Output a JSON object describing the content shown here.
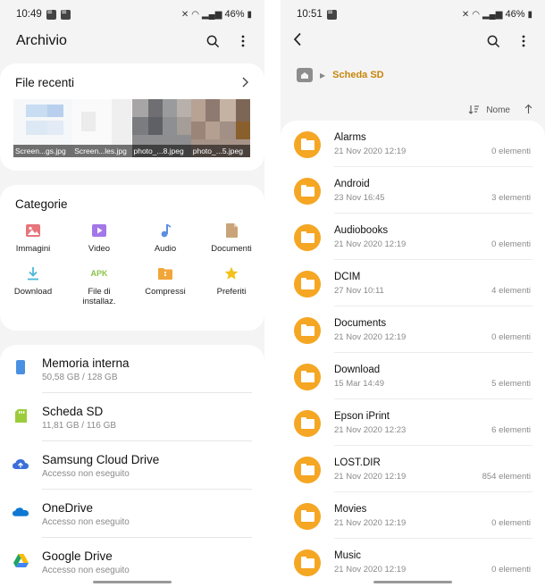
{
  "left": {
    "status": {
      "time": "10:49",
      "battery": "46%"
    },
    "title": "Archivio",
    "recent": {
      "title": "File recenti",
      "thumbs": [
        {
          "caption": "Screen...gs.jpg"
        },
        {
          "caption": "Screen...les.jpg"
        },
        {
          "caption": "photo_...8.jpeg"
        },
        {
          "caption": "photo_...5.jpeg"
        }
      ]
    },
    "categories": {
      "title": "Categorie",
      "items": [
        {
          "label": "Immagini",
          "icon": "image-icon",
          "color": "#e8747c"
        },
        {
          "label": "Video",
          "icon": "video-icon",
          "color": "#a477e8"
        },
        {
          "label": "Audio",
          "icon": "audio-icon",
          "color": "#5b8fe0"
        },
        {
          "label": "Documenti",
          "icon": "document-icon",
          "color": "#c9a47a"
        },
        {
          "label": "Download",
          "icon": "download-icon",
          "color": "#4bb7d8"
        },
        {
          "label": "File di\ninstallaz.",
          "icon": "apk-icon",
          "color": "#8bc34a",
          "badge": "APK"
        },
        {
          "label": "Compressi",
          "icon": "zip-icon",
          "color": "#f2a63a"
        },
        {
          "label": "Preferiti",
          "icon": "star-icon",
          "color": "#f2c21b"
        }
      ]
    },
    "storage": [
      {
        "name": "Memoria interna",
        "sub": "50,58 GB / 128 GB",
        "icon": "phone-icon",
        "color": "#4a90e2"
      },
      {
        "name": "Scheda SD",
        "sub": "11,81 GB / 116 GB",
        "icon": "sd-card-icon",
        "color": "#9ccc3b"
      },
      {
        "name": "Samsung Cloud Drive",
        "sub": "Accesso non eseguito",
        "icon": "samsung-cloud-icon",
        "color": "#3b6fd8"
      },
      {
        "name": "OneDrive",
        "sub": "Accesso non eseguito",
        "icon": "onedrive-icon",
        "color": "#0f78d4"
      },
      {
        "name": "Google Drive",
        "sub": "Accesso non eseguito",
        "icon": "google-drive-icon",
        "color": "#1fa463"
      }
    ]
  },
  "right": {
    "status": {
      "time": "10:51",
      "battery": "46%"
    },
    "breadcrumb": {
      "current": "Scheda SD"
    },
    "sort": {
      "label": "Nome"
    },
    "files": [
      {
        "name": "Alarms",
        "date": "21 Nov 2020 12:19",
        "count": "0 elementi"
      },
      {
        "name": "Android",
        "date": "23 Nov 16:45",
        "count": "3 elementi"
      },
      {
        "name": "Audiobooks",
        "date": "21 Nov 2020 12:19",
        "count": "0 elementi"
      },
      {
        "name": "DCIM",
        "date": "27 Nov 10:11",
        "count": "4 elementi"
      },
      {
        "name": "Documents",
        "date": "21 Nov 2020 12:19",
        "count": "0 elementi"
      },
      {
        "name": "Download",
        "date": "15 Mar 14:49",
        "count": "5 elementi"
      },
      {
        "name": "Epson iPrint",
        "date": "21 Nov 2020 12:23",
        "count": "6 elementi"
      },
      {
        "name": "LOST.DIR",
        "date": "21 Nov 2020 12:19",
        "count": "854 elementi"
      },
      {
        "name": "Movies",
        "date": "21 Nov 2020 12:19",
        "count": "0 elementi"
      },
      {
        "name": "Music",
        "date": "21 Nov 2020 12:19",
        "count": "0 elementi"
      }
    ]
  }
}
